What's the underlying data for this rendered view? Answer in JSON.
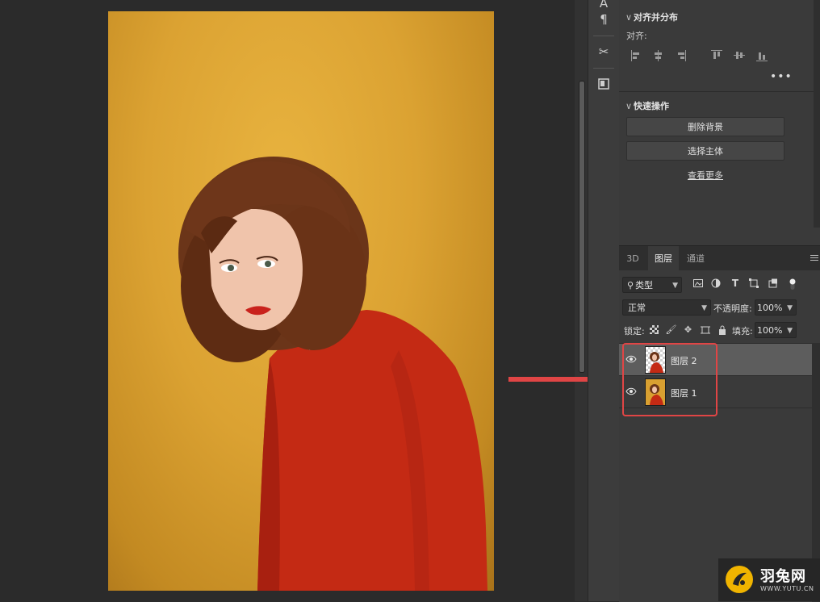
{
  "properties": {
    "align_section": {
      "title": "对齐并分布",
      "align_label": "对齐:",
      "more_icon": "more-horizontal-icon"
    },
    "quick_actions": {
      "title": "快速操作",
      "remove_bg": "删除背景",
      "select_subject": "选择主体",
      "see_more": "查看更多"
    }
  },
  "layers_panel": {
    "tabs": [
      {
        "label": "3D"
      },
      {
        "label": "图层",
        "active": true
      },
      {
        "label": "通道"
      }
    ],
    "filter": {
      "label": "类型"
    },
    "blend_mode": "正常",
    "opacity_label": "不透明度:",
    "opacity_value": "100%",
    "lock_label": "锁定:",
    "fill_label": "填充:",
    "fill_value": "100%",
    "layers": [
      {
        "name": "图层 2",
        "selected": true,
        "visible": true
      },
      {
        "name": "图层 1",
        "selected": false,
        "visible": true
      }
    ]
  },
  "watermark": {
    "brand": "羽兔网",
    "url": "WWW.YUTU.CN"
  },
  "colors": {
    "highlight": "#e04545",
    "arrow": "#e04545",
    "panel_bg": "#3a3a3a",
    "canvas_bg": "#2b2b2b",
    "photo_backdrop": "#dba232",
    "sweater": "#c42a14"
  }
}
